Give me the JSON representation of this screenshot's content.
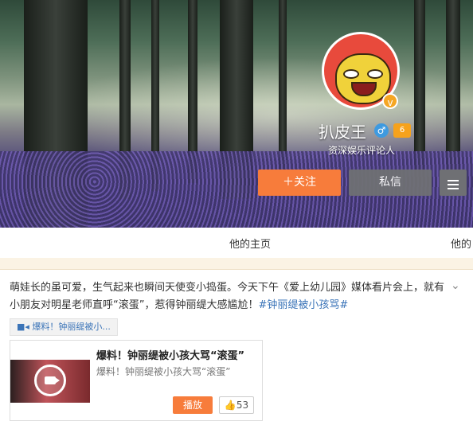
{
  "profile": {
    "username": "扒皮王",
    "bio": "资深娱乐评论人",
    "gender_icon": "♂",
    "vip_label": "6",
    "verified_icon": "v"
  },
  "actions": {
    "follow_label": "＋关注",
    "message_label": "私信"
  },
  "nav": {
    "home_label": "他的主页",
    "other_label": "他的"
  },
  "post": {
    "text": "萌娃长的虽可爱，生气起来也瞬间天使变小捣蛋。今天下午《爱上幼儿园》媒体看片会上，就有小朋友对明星老师直呼“滚蛋”，惹得钟丽缇大感尴尬！",
    "hashtag": "#钟丽缇被小孩骂#",
    "link_tag": "爆料！钟丽缇被小...",
    "card": {
      "title": "爆料！钟丽缇被小孩大骂“滚蛋”",
      "subtitle": "爆料！钟丽缇被小孩大骂“滚蛋”",
      "play_label": "播放",
      "like_count": "53"
    }
  },
  "colors": {
    "accent_orange": "#f77c3b",
    "link_blue": "#3b74b8"
  }
}
